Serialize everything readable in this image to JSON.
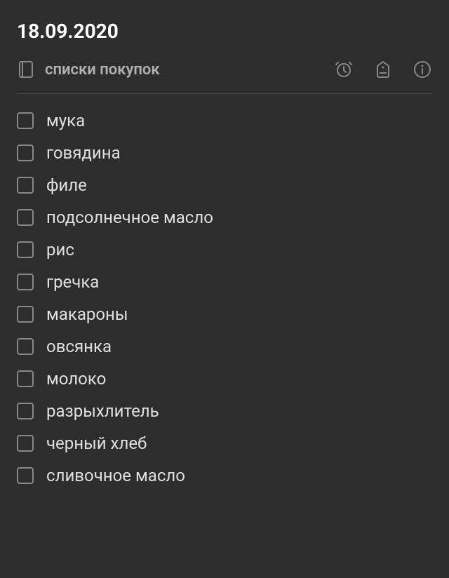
{
  "header": {
    "title": "18.09.2020"
  },
  "toolbar": {
    "notebook_label": "списки покупок"
  },
  "checklist": {
    "items": [
      {
        "label": "мука",
        "checked": false
      },
      {
        "label": "говядина",
        "checked": false
      },
      {
        "label": "филе",
        "checked": false
      },
      {
        "label": "подсолнечное масло",
        "checked": false
      },
      {
        "label": "рис",
        "checked": false
      },
      {
        "label": "гречка",
        "checked": false
      },
      {
        "label": "макароны",
        "checked": false
      },
      {
        "label": "овсянка",
        "checked": false
      },
      {
        "label": "молоко",
        "checked": false
      },
      {
        "label": "разрыхлитель",
        "checked": false
      },
      {
        "label": "черный хлеб",
        "checked": false
      },
      {
        "label": "сливочное масло",
        "checked": false
      }
    ]
  }
}
